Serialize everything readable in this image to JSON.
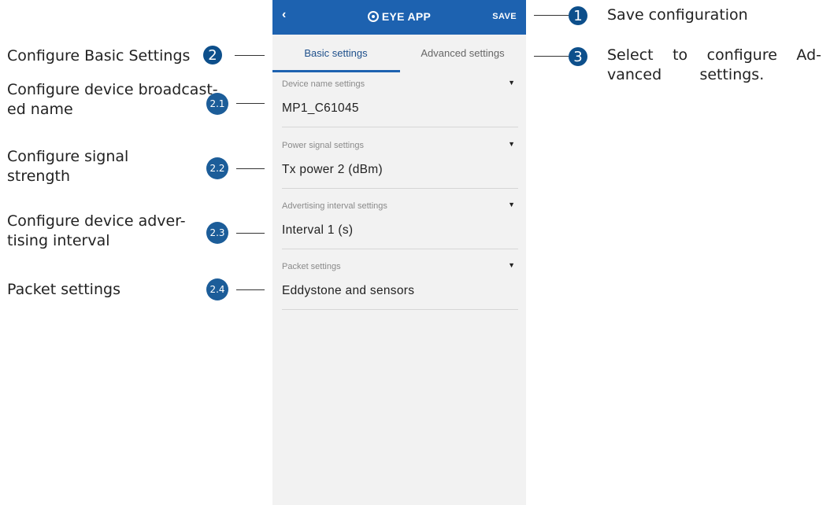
{
  "app": {
    "back_icon": "chevron-left-icon",
    "title": "EYE APP",
    "logo_icon": "eye-logo-icon",
    "save_label": "SAVE"
  },
  "tabs": [
    {
      "label": "Basic settings",
      "active": true
    },
    {
      "label": "Advanced settings",
      "active": false
    }
  ],
  "settings": [
    {
      "label": "Device name settings",
      "value": "MP1_C61045"
    },
    {
      "label": "Power signal settings",
      "value": "Tx power 2 (dBm)"
    },
    {
      "label": "Advertising interval settings",
      "value": "Interval 1 (s)"
    },
    {
      "label": "Packet settings",
      "value": "Eddystone and sensors"
    }
  ],
  "annotations": {
    "n1": {
      "number": "1",
      "text": "Save configuration"
    },
    "n2": {
      "number": "2",
      "text": "Configure Basic Settings"
    },
    "n3": {
      "number": "3",
      "line1": "Select  to  configure  Ad-",
      "line2": "vanced        settings."
    },
    "n21": {
      "number": "2.1",
      "line1": "Configure device broadcast-",
      "line2": "ed name"
    },
    "n22": {
      "number": "2.2",
      "line1": "Configure signal",
      "line2": "strength"
    },
    "n23": {
      "number": "2.3",
      "line1": "Configure device adver-",
      "line2": "tising interval"
    },
    "n24": {
      "number": "2.4",
      "text": "Packet settings"
    }
  },
  "colors": {
    "accent": "#1d62b0",
    "badge": "#0d4f8b"
  }
}
